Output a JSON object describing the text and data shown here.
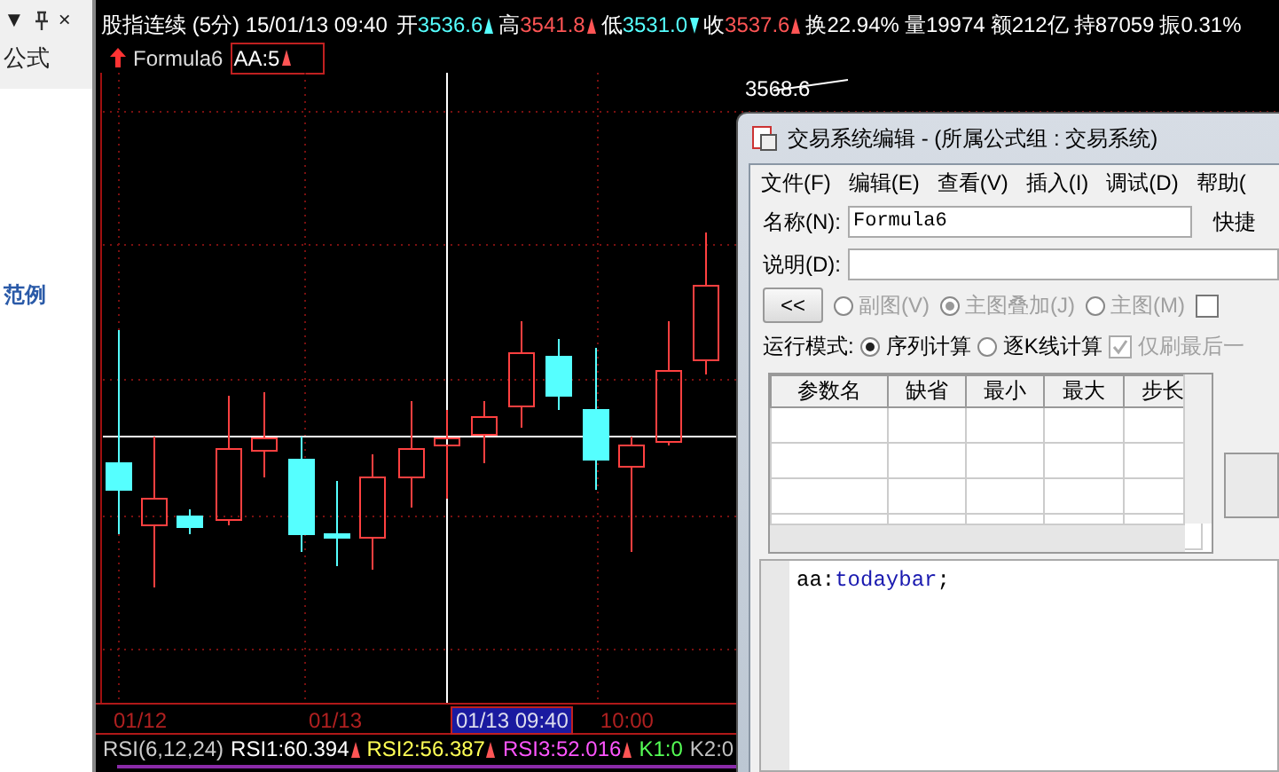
{
  "panel": {
    "title": "公式",
    "buttons": [
      {
        "kind": "dropdown",
        "label": "▼"
      },
      {
        "kind": "pin"
      },
      {
        "kind": "close",
        "label": "×"
      }
    ],
    "items": [
      "范例"
    ]
  },
  "quote_header": {
    "title": "股指连续 (5分) 15/01/13 09:40",
    "stats": [
      {
        "label": "开",
        "value": "3536.6",
        "color": "#55ffff",
        "kind": "rise"
      },
      {
        "label": "高",
        "value": "3541.8",
        "color": "#ff5555",
        "kind": "rise"
      },
      {
        "label": "低",
        "value": "3531.0",
        "color": "#55ffff",
        "kind": "fall"
      },
      {
        "label": "收",
        "value": "3537.6",
        "color": "#ff5555",
        "kind": "rise"
      },
      {
        "label": "换",
        "value": "22.94%",
        "color": "#ffffff",
        "kind": "flat"
      },
      {
        "label": "量",
        "value": "19974",
        "color": "#ffffff",
        "kind": "flat"
      },
      {
        "label": "额",
        "value": "212亿",
        "color": "#ffffff",
        "kind": "flat"
      },
      {
        "label": "持",
        "value": "87059",
        "color": "#ffffff",
        "kind": "flat"
      },
      {
        "label": "振",
        "value": "0.31%",
        "color": "#ffffff",
        "kind": "flat"
      }
    ]
  },
  "legend": {
    "formula": "Formula6",
    "value": "AA:5",
    "kind": "rise"
  },
  "price_label": "3568.6",
  "date_axis": [
    {
      "label": "01/12",
      "selected": false
    },
    {
      "label": "01/13",
      "selected": false
    },
    {
      "label": "01/13 09:40",
      "selected": true
    },
    {
      "label": "10:00",
      "selected": false
    }
  ],
  "indicator": {
    "name": "RSI(6,12,24)",
    "values": [
      {
        "text": "RSI1:60.394",
        "color": "#ffffff",
        "kind": "rise"
      },
      {
        "text": "RSI2:56.387",
        "color": "#ffff55",
        "kind": "rise"
      },
      {
        "text": "RSI3:52.016",
        "color": "#ff55ff",
        "kind": "rise"
      },
      {
        "text": "K1:0",
        "color": "#55ff55",
        "kind": "flat"
      },
      {
        "text": "K2:0",
        "color": "#c0c0c0",
        "kind": "flat"
      }
    ]
  },
  "dialog": {
    "title": "交易系统编辑 - (所属公式组 : 交易系统)",
    "menu": [
      "文件(F)",
      "编辑(E)",
      "查看(V)",
      "插入(I)",
      "调试(D)",
      "帮助("
    ],
    "name_label": "名称(N):",
    "name_value": "Formula6",
    "shortcut_label": "快捷",
    "desc_label": "说明(D):",
    "collapse_button": "<<",
    "chart_types": [
      {
        "label": "副图(V)",
        "selected": false
      },
      {
        "label": "主图叠加(J)",
        "selected": true
      },
      {
        "label": "主图(M)",
        "selected": false
      }
    ],
    "chart_types_disabled": true,
    "extra_checkbox": {
      "checked": false
    },
    "run_mode": {
      "label": "运行模式:",
      "options": [
        {
          "label": "序列计算",
          "selected": true
        },
        {
          "label": "逐K线计算",
          "selected": false
        }
      ],
      "last_only": {
        "label": "仅刷最后一",
        "checked": true,
        "disabled": true
      }
    },
    "params_table": {
      "columns": [
        "参数名",
        "缺省",
        "最小",
        "最大",
        "步长"
      ]
    },
    "code": [
      {
        "kind": "plain",
        "text": "aa:"
      },
      {
        "kind": "function",
        "text": "todaybar"
      },
      {
        "kind": "plain",
        "text": ";"
      }
    ]
  }
}
